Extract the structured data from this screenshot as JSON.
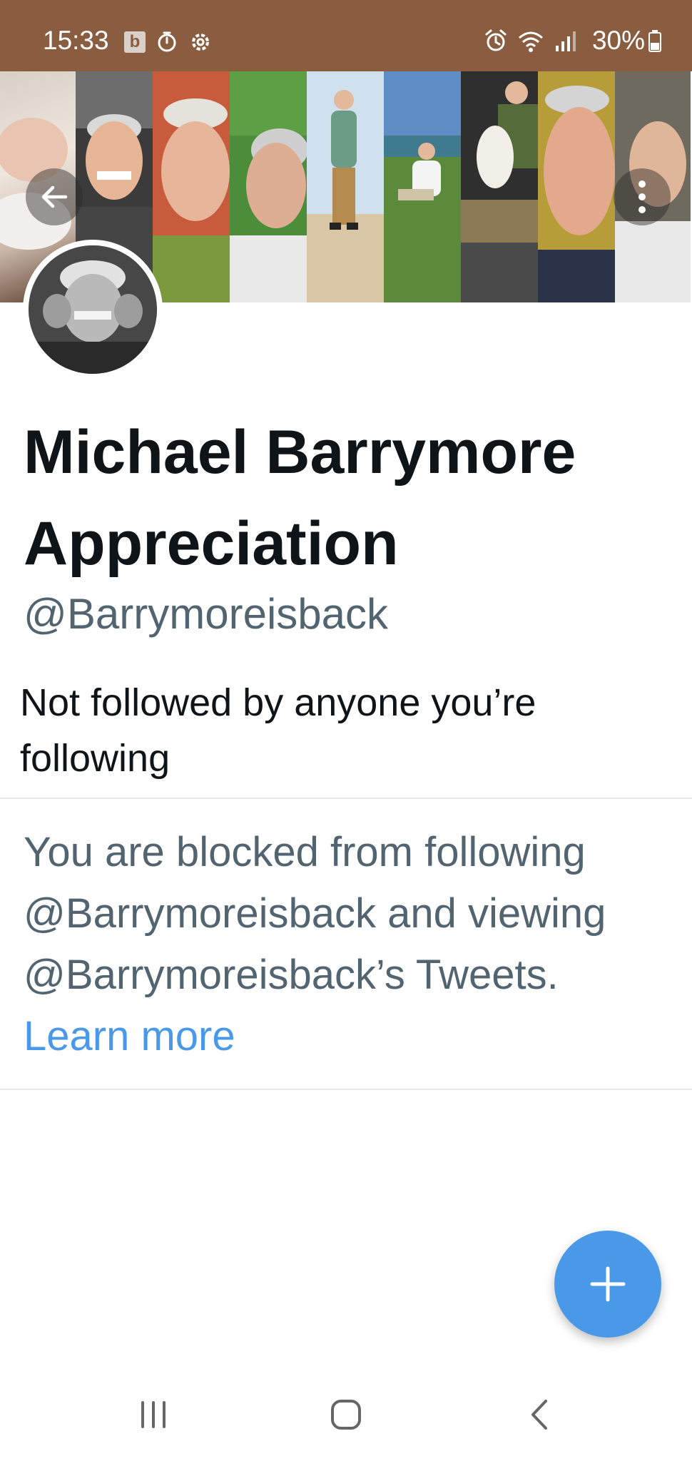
{
  "status_bar": {
    "time": "15:33",
    "b_badge": "b",
    "battery_percent": "30%",
    "icons": [
      "b-app-icon",
      "timer-icon",
      "settings-gear-icon",
      "alarm-icon",
      "wifi-icon",
      "signal-icon",
      "battery-icon"
    ],
    "background_color": "#8a5d40"
  },
  "banner": {
    "photos": [
      "photo-1",
      "photo-2",
      "photo-3",
      "photo-4",
      "photo-5",
      "photo-6",
      "photo-7",
      "photo-8",
      "photo-9"
    ]
  },
  "profile": {
    "name_line1": "Michael Barrymore",
    "name_line2": "Appreciation",
    "handle": "@Barrymoreisback",
    "followers_note_line1": "Not followed by anyone you’re",
    "followers_note_line2": "following"
  },
  "blocked": {
    "line1": "You are blocked from following",
    "line2": "@Barrymoreisback and viewing",
    "line3": "@Barrymoreisback’s Tweets.",
    "learn_more": "Learn more"
  },
  "fab": {
    "icon": "plus-icon",
    "color": "#4a99e9"
  },
  "nav_bar": {
    "icons": [
      "recents-icon",
      "home-icon",
      "back-icon"
    ]
  },
  "colors": {
    "link": "#4a99e9",
    "secondary_text": "#536471",
    "primary_text": "#0f1419"
  }
}
